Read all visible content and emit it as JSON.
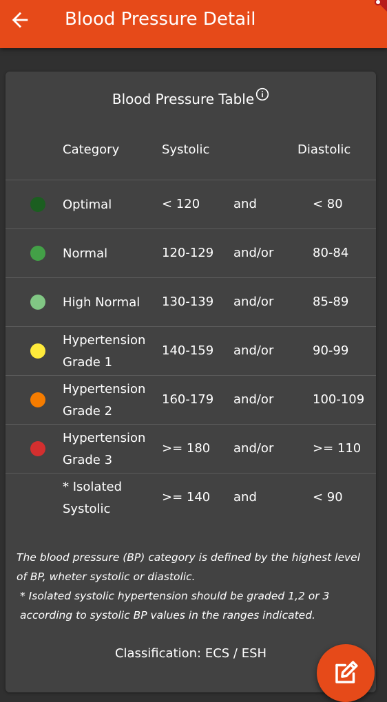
{
  "appbar": {
    "title": "Blood Pressure Detail",
    "back_icon": "arrow-left-icon",
    "color": "#e64a19"
  },
  "table": {
    "title": "Blood Pressure Table",
    "info_icon": "info-icon",
    "headers": {
      "category": "Category",
      "systolic": "Systolic",
      "diastolic": "Diastolic"
    },
    "rows": [
      {
        "color": "#1b5e20",
        "category": "Optimal",
        "systolic": "< 120",
        "conj": "and",
        "diastolic": "< 80"
      },
      {
        "color": "#43a047",
        "category": "Normal",
        "systolic": "120-129",
        "conj": "and/or",
        "diastolic": "80-84"
      },
      {
        "color": "#81c784",
        "category": "High Normal",
        "systolic": "130-139",
        "conj": "and/or",
        "diastolic": "85-89"
      },
      {
        "color": "#ffeb3b",
        "category": "Hypertension Grade 1",
        "systolic": "140-159",
        "conj": "and/or",
        "diastolic": "90-99"
      },
      {
        "color": "#f57c00",
        "category": "Hypertension Grade 2",
        "systolic": "160-179",
        "conj": "and/or",
        "diastolic": "100-109"
      },
      {
        "color": "#d32f2f",
        "category": "Hypertension Grade 3",
        "systolic": ">= 180",
        "conj": "and/or",
        "diastolic": ">= 110"
      },
      {
        "color": "",
        "category": "* Isolated Systolic",
        "systolic": ">= 140",
        "conj": "and",
        "diastolic": "< 90"
      }
    ]
  },
  "notes": {
    "line1": "The blood pressure (BP) category is defined by the highest level of BP, wheter systolic or diastolic.",
    "line2": "* Isolated systolic hypertension should be graded 1,2 or 3 according to systolic BP values in the ranges indicated."
  },
  "classification": "Classification: ECS / ESH",
  "fab": {
    "icon": "edit-icon",
    "color": "#e64a19"
  }
}
